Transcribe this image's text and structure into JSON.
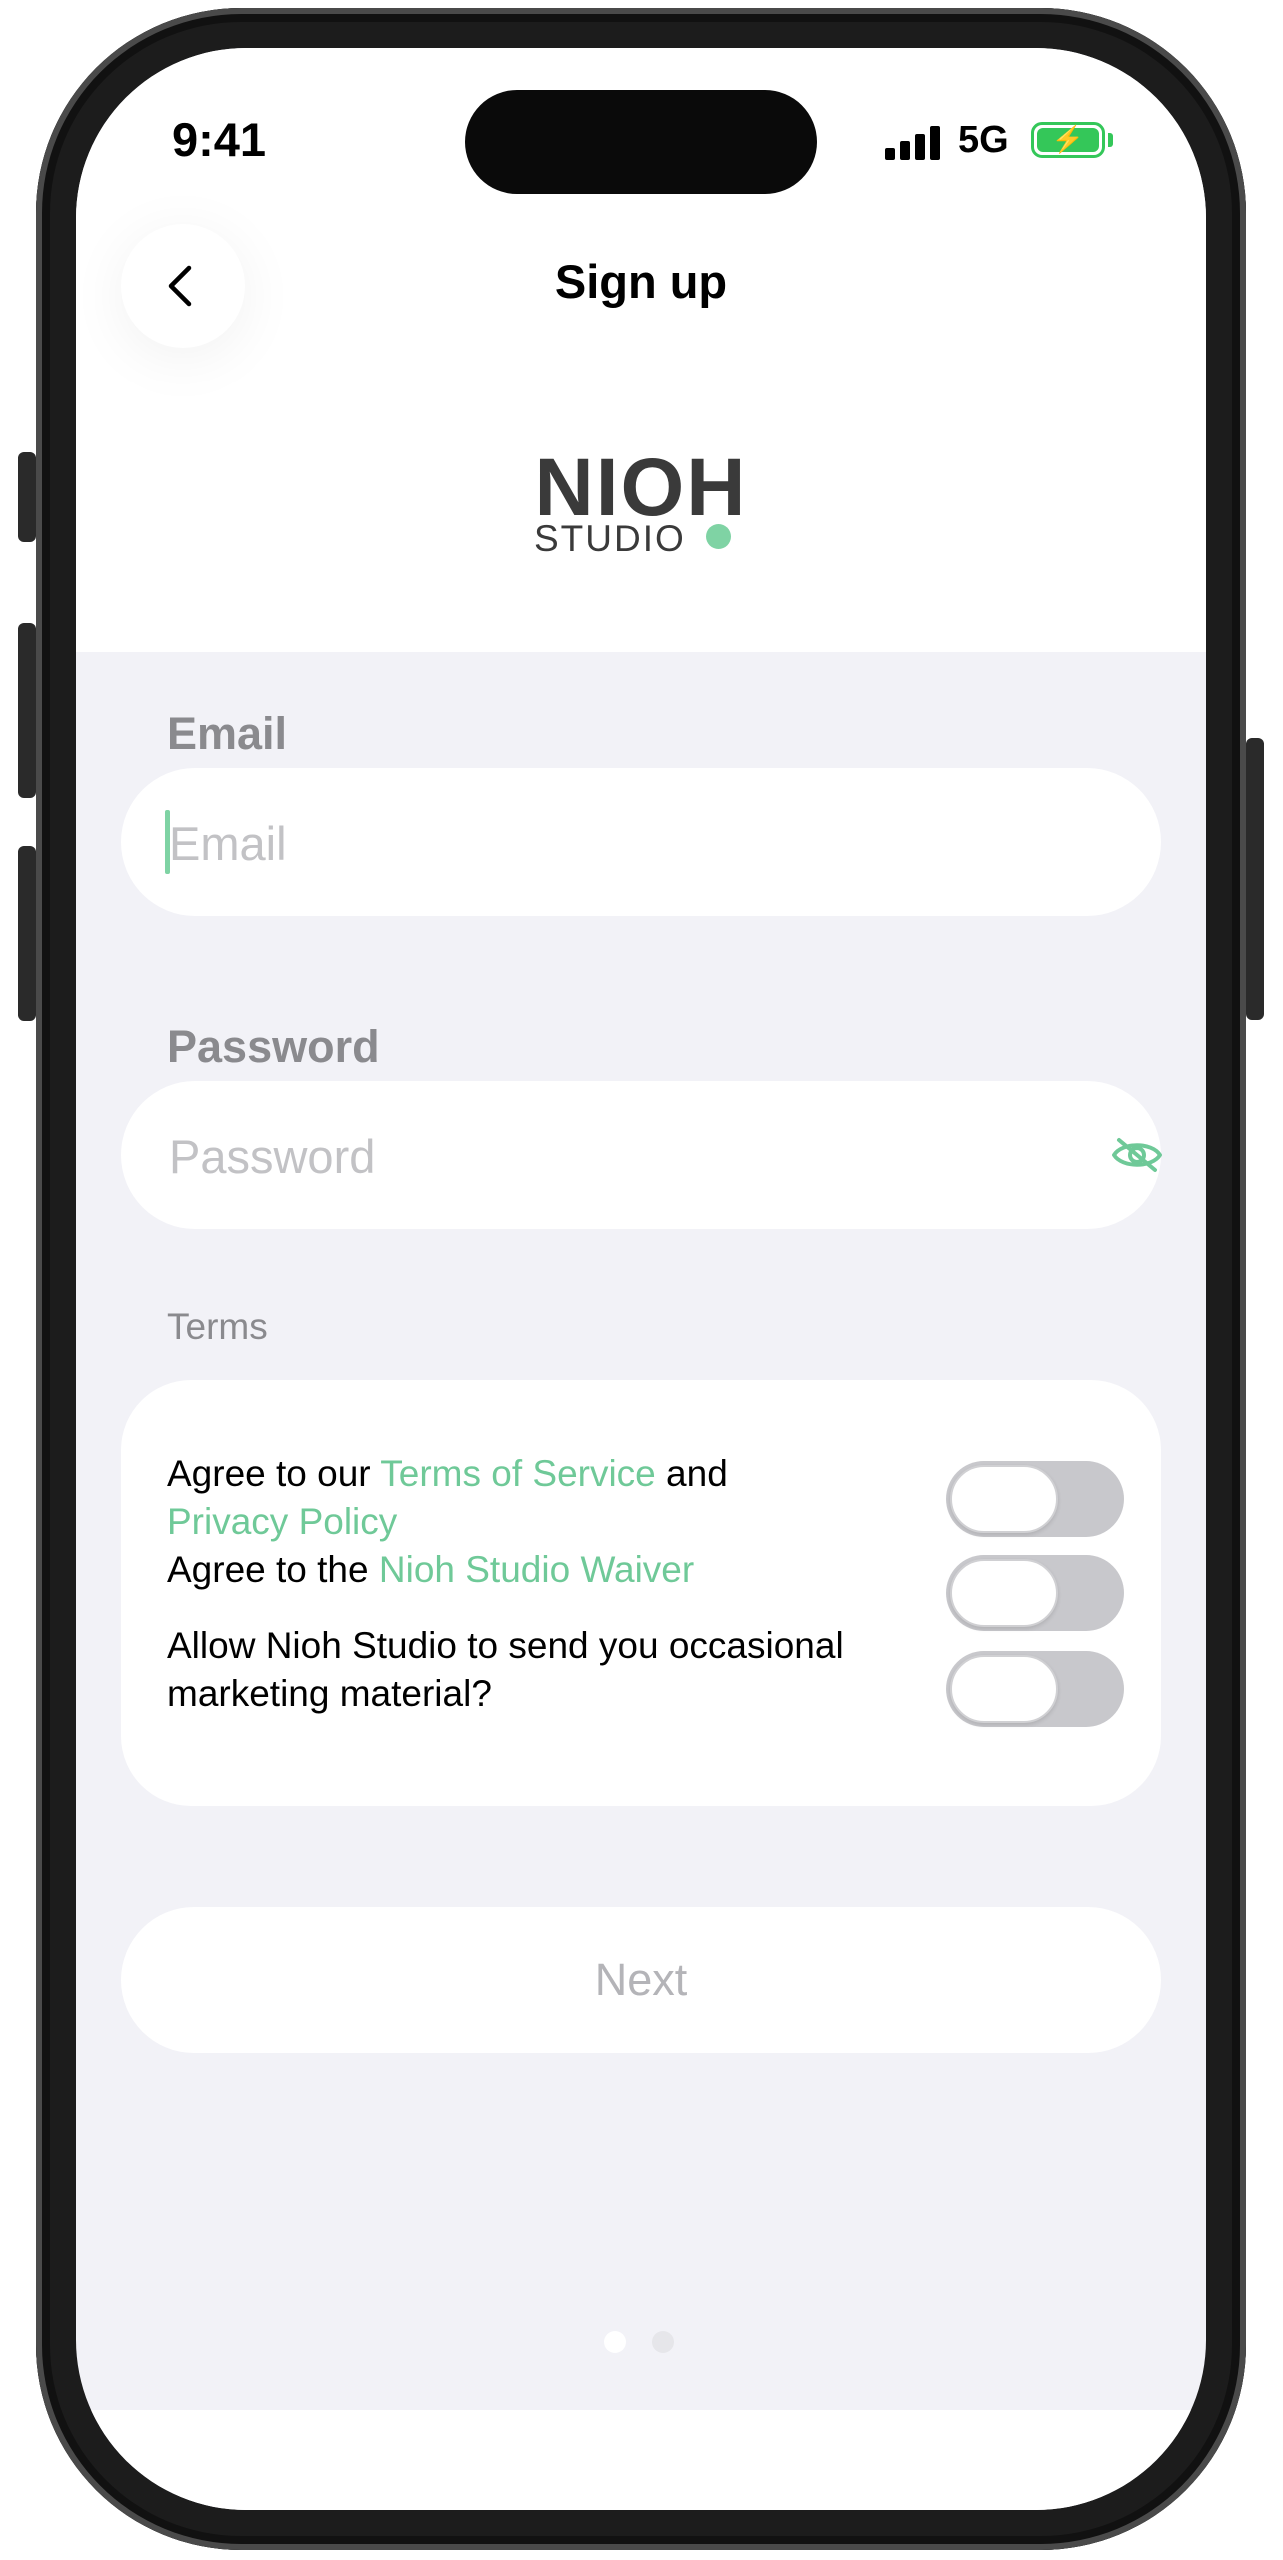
{
  "status_bar": {
    "time": "9:41",
    "network": "5G"
  },
  "header": {
    "title": "Sign up"
  },
  "logo": {
    "main": "NIOH",
    "sub": "STUDIO"
  },
  "form": {
    "email": {
      "label": "Email",
      "placeholder": "Email",
      "value": ""
    },
    "password": {
      "label": "Password",
      "placeholder": "Password",
      "value": ""
    }
  },
  "terms": {
    "label": "Terms",
    "items": [
      {
        "text_before": "Agree to our ",
        "link1": "Terms of Service",
        "text_mid": " and ",
        "link2": "Privacy Policy",
        "checked": false
      },
      {
        "text_before": "Agree to the ",
        "link1": "Nioh Studio Waiver",
        "checked": false
      },
      {
        "text": "Allow Nioh Studio to send you occasional marketing material?",
        "checked": false
      }
    ]
  },
  "next_button": {
    "label": "Next"
  },
  "pagination": {
    "total": 2,
    "current": 1
  },
  "colors": {
    "accent": "#7fd3a4",
    "link": "#6fc998",
    "background": "#f2f2f7",
    "battery": "#34c759"
  },
  "icons": {
    "back": "chevron-left-icon",
    "password_toggle": "eye-slash-icon"
  }
}
